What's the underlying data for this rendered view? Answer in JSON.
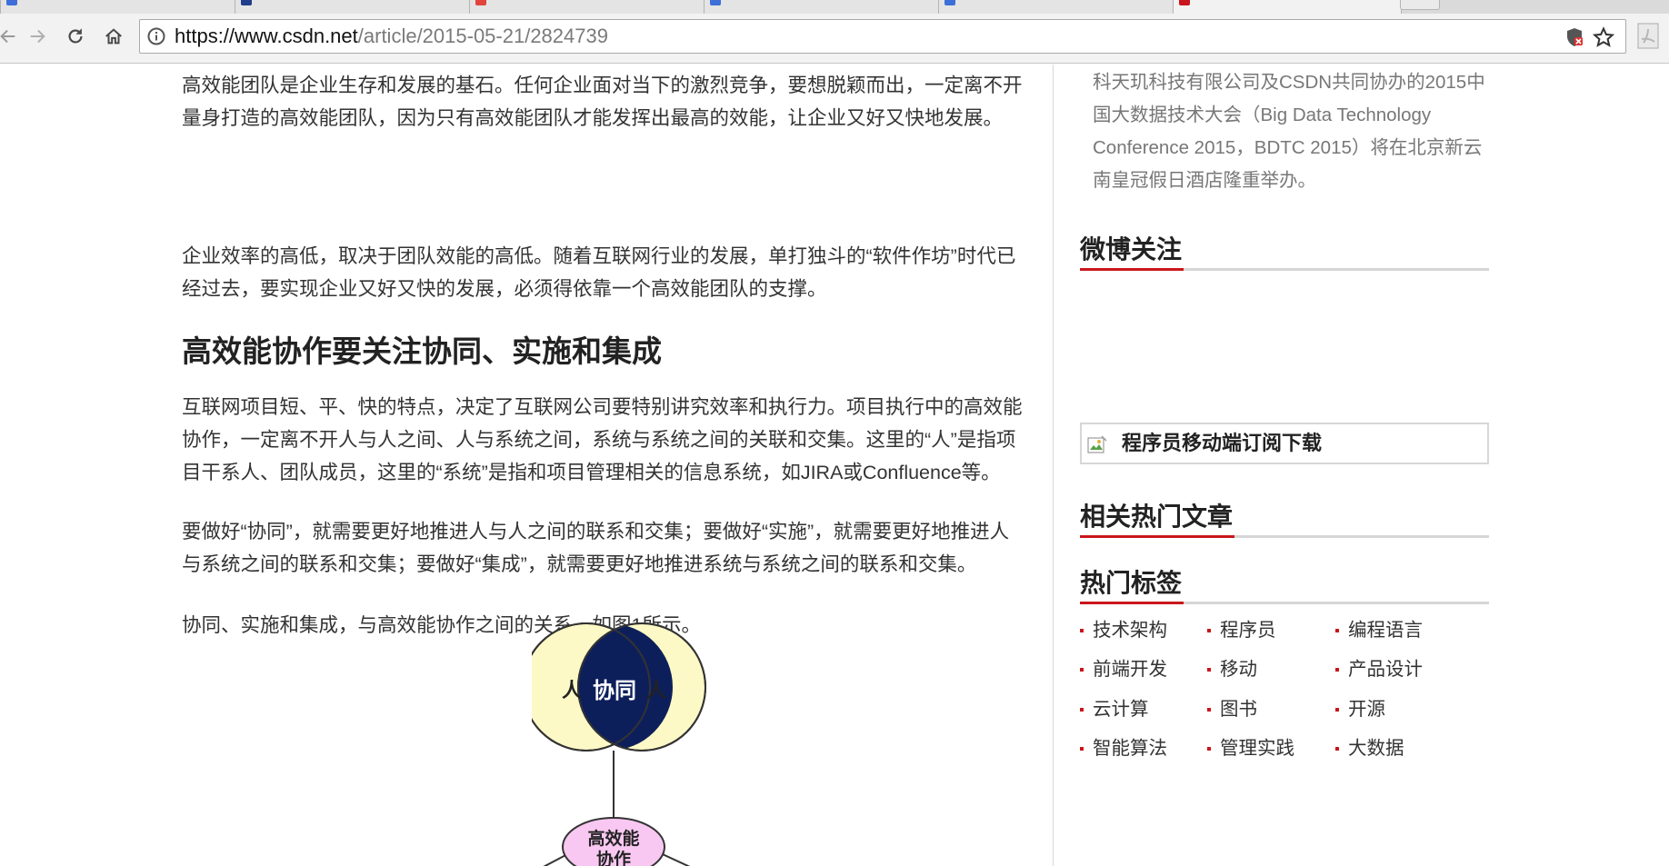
{
  "browser": {
    "url_host": "https://www.csdn.net",
    "url_path": "/article/2015-05-21/2824739"
  },
  "colors": {
    "accent_red": "#c9161c",
    "venn_yellow": "#fdf9c6",
    "venn_navy": "#0d1f5b",
    "node_pink": "#f9c8f2"
  },
  "icons": [
    "back-arrow-icon",
    "forward-arrow-icon",
    "reload-icon",
    "home-icon",
    "info-icon",
    "shield-blocked-icon",
    "star-icon",
    "pdf-icon",
    "broken-image-icon"
  ],
  "article": {
    "paragraphs_top": [
      "高效能团队是企业生存和发展的基石。任何企业面对当下的激烈竞争，要想脱颖而出，一定离不开量身打造的高效能团队，因为只有高效能团队才能发挥出最高的效能，让企业又好又快地发展。",
      "企业效率的高低，取决于团队效能的高低。随着互联网行业的发展，单打独斗的“软件作坊”时代已经过去，要实现企业又好又快的发展，必须得依靠一个高效能团队的支撑。"
    ],
    "heading": "高效能协作要关注协同、实施和集成",
    "paragraphs_bottom": [
      "互联网项目短、平、快的特点，决定了互联网公司要特别讲究效率和执行力。项目执行中的高效能协作，一定离不开人与人之间、人与系统之间，系统与系统之间的关联和交集。这里的“人”是指项目干系人、团队成员，这里的“系统”是指和项目管理相关的信息系统，如JIRA或Confluence等。",
      "要做好“协同”，就需要更好地推进人与人之间的联系和交集；要做好“实施”，就需要更好地推进人与系统之间的联系和交集；要做好“集成”，就需要更好地推进系统与系统之间的联系和交集。",
      "协同、实施和集成，与高效能协作之间的关系，如图1所示。"
    ],
    "figure": {
      "left_label": "人",
      "center_label": "协同",
      "right_label": "人",
      "node_line1": "高效能",
      "node_line2": "协作"
    }
  },
  "sidebar": {
    "intro": "科天玑科技有限公司及CSDN共同协办的2015中国大数据技术大会（Big Data Technology Conference 2015，BDTC 2015）将在北京新云南皇冠假日酒店隆重举办。",
    "weibo_title": "微博关注",
    "app_banner": "程序员移动端订阅下载",
    "hot_articles_title": "相关热门文章",
    "hot_tags_title": "热门标签",
    "tags": [
      "技术架构",
      "程序员",
      "编程语言",
      "前端开发",
      "移动",
      "产品设计",
      "云计算",
      "图书",
      "开源",
      "智能算法",
      "管理实践",
      "大数据"
    ]
  }
}
